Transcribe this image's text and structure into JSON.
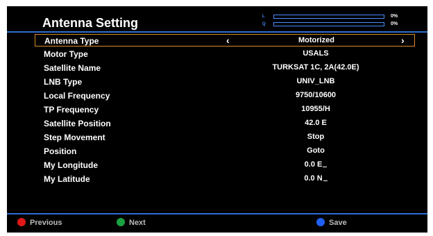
{
  "title": "Antenna Setting",
  "signal": {
    "strength": {
      "label": "L",
      "percent": "0%",
      "fill": 0
    },
    "quality": {
      "label": "Q",
      "percent": "0%",
      "fill": 0
    }
  },
  "settings": [
    {
      "name": "Antenna Type",
      "value": "Motorized"
    },
    {
      "name": "Motor Type",
      "value": "USALS"
    },
    {
      "name": "Satellite Name",
      "value": "TURKSAT 1C, 2A(42.0E)"
    },
    {
      "name": "LNB Type",
      "value": "UNIV_LNB"
    },
    {
      "name": "Local Frequency",
      "value": "9750/10600"
    },
    {
      "name": "TP Frequency",
      "value": "10955/H"
    },
    {
      "name": "Satellite Position",
      "value": "42.0 E"
    },
    {
      "name": "Step Movement",
      "value": "Stop"
    },
    {
      "name": "Position",
      "value": "Goto"
    },
    {
      "name": "My Longitude",
      "value": "0.0 E"
    },
    {
      "name": "My Latitude",
      "value": "0.0 N"
    }
  ],
  "arrows": {
    "left": "‹",
    "right": "›"
  },
  "footer": {
    "previous": {
      "label": "Previous",
      "color": "#e01818"
    },
    "next": {
      "label": "Next",
      "color": "#1aa040"
    },
    "save": {
      "label": "Save",
      "color": "#2060f0"
    }
  }
}
